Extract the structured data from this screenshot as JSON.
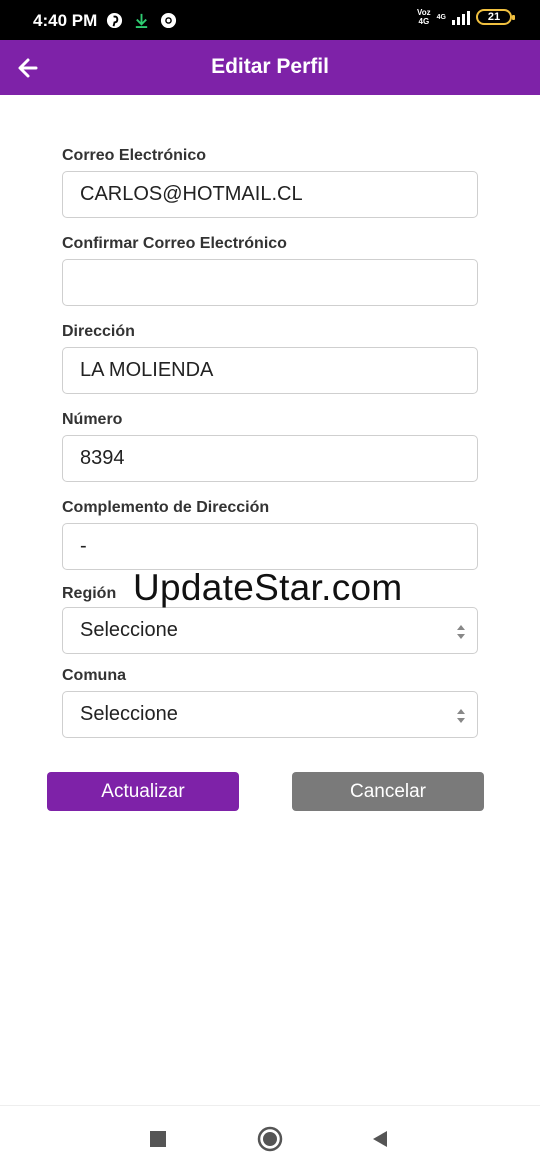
{
  "status_bar": {
    "time": "4:40 PM",
    "network_top": "Voz",
    "network_bottom": "4G",
    "network2_top": "4G",
    "battery": "21",
    "icons": [
      "pinterest-icon",
      "download-icon",
      "chrome-icon",
      "signal-icon",
      "battery-icon"
    ]
  },
  "app_bar": {
    "title": "Editar Perfil",
    "back_icon": "arrow-left-icon",
    "background": "#7e22a8"
  },
  "form": {
    "fields": [
      {
        "label": "Correo Electrónico",
        "value": "CARLOS@HOTMAIL.CL"
      },
      {
        "label": "Confirmar Correo Electrónico",
        "value": ""
      },
      {
        "label": "Dirección",
        "value": "LA MOLIENDA"
      },
      {
        "label": "Número",
        "value": "8394"
      },
      {
        "label": "Complemento de Dirección",
        "value": "-"
      }
    ],
    "selects": [
      {
        "label": "Región",
        "value": "Seleccione"
      },
      {
        "label": "Comuna",
        "value": "Seleccione"
      }
    ]
  },
  "watermark": "UpdateStar.com",
  "buttons": {
    "update_label": "Actualizar",
    "cancel_label": "Cancelar",
    "update_color": "#7e22a8",
    "cancel_color": "#7a7a7a"
  },
  "nav_bar": {
    "icons": [
      "recent-apps-icon",
      "home-icon",
      "back-icon"
    ]
  }
}
